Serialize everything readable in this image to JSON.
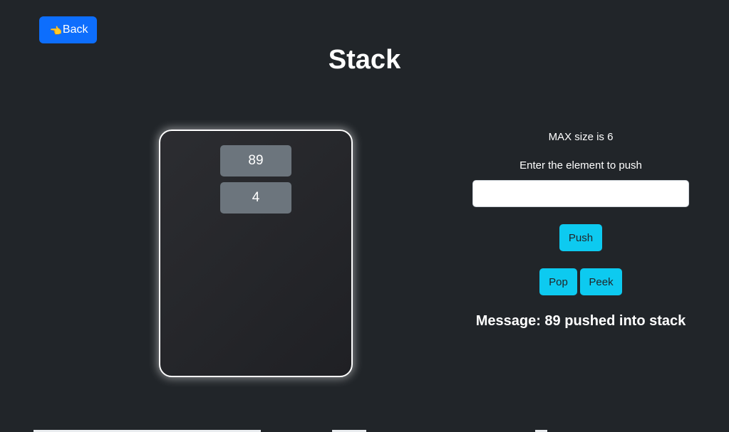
{
  "back_button": {
    "icon": "backhand-index-pointing-left-icon",
    "icon_glyph": "👈",
    "label": "Back"
  },
  "title": "Stack",
  "stack": {
    "items": [
      "89",
      "4"
    ]
  },
  "controls": {
    "max_size_text": "MAX size is 6",
    "enter_label": "Enter the element to push",
    "input_value": "",
    "input_placeholder": "",
    "push_label": "Push",
    "pop_label": "Pop",
    "peek_label": "Peek"
  },
  "message": "Message: 89 pushed into stack",
  "colors": {
    "background": "#212529",
    "primary": "#0d6efd",
    "info": "#0dcaf0",
    "stack_item": "#6c757d"
  }
}
